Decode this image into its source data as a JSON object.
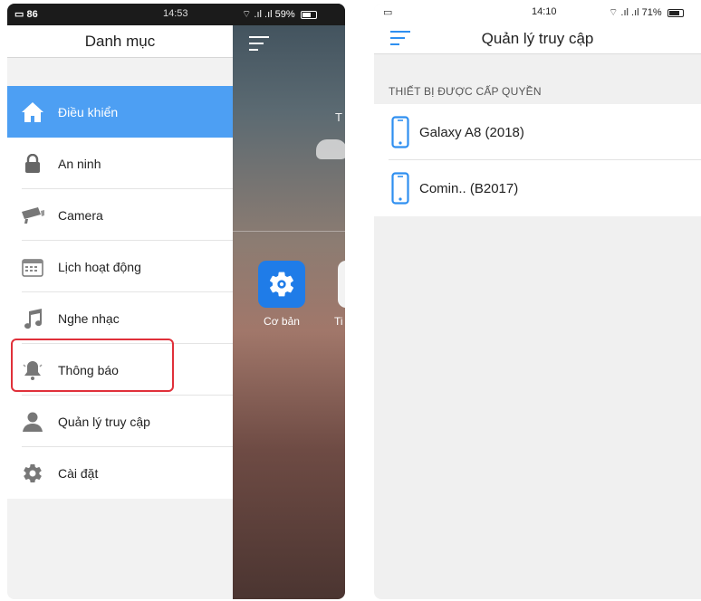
{
  "left_screen": {
    "status_bar": {
      "left": "86",
      "time": "14:53",
      "battery": "59%"
    },
    "drawer": {
      "title": "Danh mục",
      "items": [
        {
          "label": "Điều khiển",
          "icon": "home-icon",
          "active": true
        },
        {
          "label": "An ninh",
          "icon": "lock-icon"
        },
        {
          "label": "Camera",
          "icon": "camera-icon"
        },
        {
          "label": "Lịch hoạt động",
          "icon": "calendar-icon"
        },
        {
          "label": "Nghe nhạc",
          "icon": "music-note-icon"
        },
        {
          "label": "Thông báo",
          "icon": "bell-icon"
        },
        {
          "label": "Quản lý truy cập",
          "icon": "user-icon",
          "highlighted": true
        },
        {
          "label": "Cài đặt",
          "icon": "gear-icon"
        }
      ]
    },
    "background_app": {
      "partial_text": "T",
      "tiles": [
        {
          "label": "Cơ bản",
          "icon": "gear-icon"
        },
        {
          "label": "Ti"
        }
      ]
    }
  },
  "right_screen": {
    "status_bar": {
      "time": "14:10",
      "battery": "71%"
    },
    "header": {
      "title": "Quản lý truy cập"
    },
    "section_label": "THIẾT BỊ ĐƯỢC CẤP QUYỀN",
    "devices": [
      {
        "name": "Galaxy A8 (2018)",
        "icon": "smartphone-icon"
      },
      {
        "name": "Comin.. (B2017)",
        "icon": "smartphone-icon"
      }
    ]
  },
  "colors": {
    "accent": "#4d9ff3",
    "highlight_border": "#e0303a",
    "tile_blue": "#1f7ce8"
  }
}
